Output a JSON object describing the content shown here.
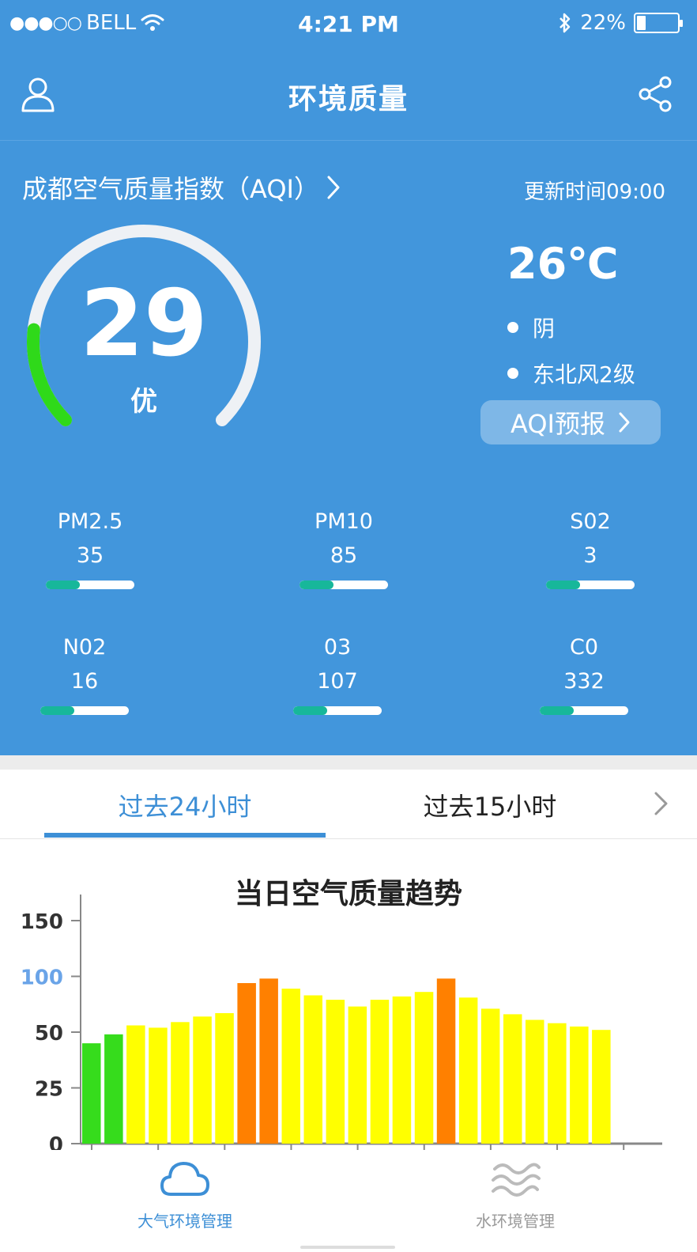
{
  "status_bar": {
    "signal": "●●●○○",
    "carrier": "BELL",
    "time": "4:21 PM",
    "battery": "22%",
    "battery_level": 0.22
  },
  "header": {
    "title": "环境质量",
    "user_icon": "user-icon",
    "share_icon": "share-icon"
  },
  "aqi": {
    "heading": "成都空气质量指数（AQI）",
    "update_time": "更新时间09:00",
    "value": "29",
    "level": "优",
    "gauge_fraction": 0.19,
    "gauge_color": "#2fd91a"
  },
  "weather": {
    "temperature": "26℃",
    "conditions": [
      "阴",
      "东北风2级"
    ],
    "forecast_button": "AQI预报"
  },
  "pollutants": [
    {
      "name": "PM2.5",
      "value": "35",
      "level": 0.38
    },
    {
      "name": "PM10",
      "value": "85",
      "level": 0.38
    },
    {
      "name": "S02",
      "value": "3",
      "level": 0.38
    },
    {
      "name": "N02",
      "value": "16",
      "level": 0.38
    },
    {
      "name": "03",
      "value": "107",
      "level": 0.38
    },
    {
      "name": "C0",
      "value": "332",
      "level": 0.38
    }
  ],
  "tabs": {
    "active": "过去24小时",
    "second": "过去15小时"
  },
  "chart_data": {
    "type": "bar",
    "title": "当日空气质量趋势",
    "y_ticks": [
      "0",
      "25",
      "50",
      "100",
      "150"
    ],
    "highlight_tick": "100",
    "values": [
      45,
      49,
      56,
      54,
      59,
      64,
      67,
      94,
      98,
      89,
      83,
      79,
      73,
      79,
      82,
      86,
      98,
      81,
      71,
      66,
      61,
      58,
      55,
      52
    ],
    "bar_colors": [
      "#36dc1c",
      "#36dc1c",
      "#ffff00",
      "#ffff00",
      "#ffff00",
      "#ffff00",
      "#ffff00",
      "#ff8000",
      "#ff8000",
      "#ffff00",
      "#ffff00",
      "#ffff00",
      "#ffff00",
      "#ffff00",
      "#ffff00",
      "#ffff00",
      "#ff8000",
      "#ffff00",
      "#ffff00",
      "#ffff00",
      "#ffff00",
      "#ffff00",
      "#ffff00",
      "#ffff00"
    ],
    "grid": false
  },
  "bottom_nav": {
    "air": "大气环境管理",
    "water": "水环境管理"
  },
  "colors": {
    "primary": "#4296dc",
    "accent": "#3d8fd6",
    "pollutant_fill": "#17b79a"
  }
}
